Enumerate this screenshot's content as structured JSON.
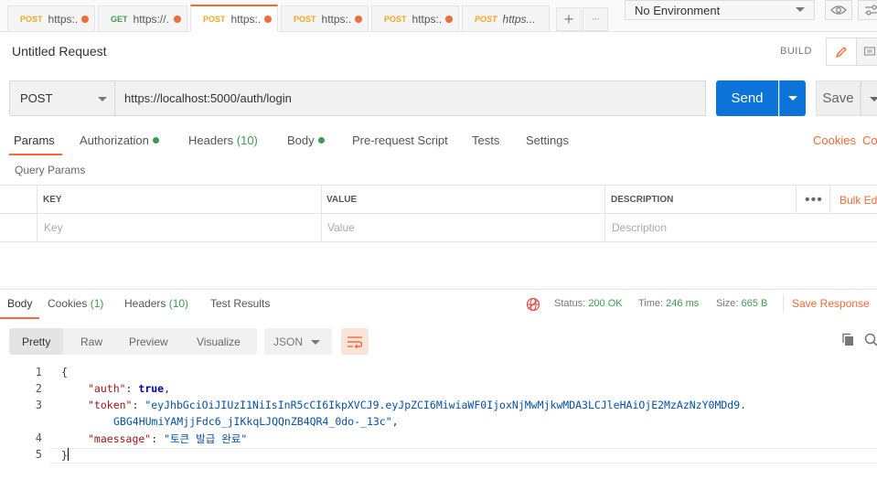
{
  "tabs": [
    {
      "method": "POST",
      "url": "https:...",
      "unsaved": true,
      "active": false
    },
    {
      "method": "GET",
      "url": "https://...",
      "unsaved": true,
      "active": false
    },
    {
      "method": "POST",
      "url": "https:...",
      "unsaved": true,
      "active": true
    },
    {
      "method": "POST",
      "url": "https:...",
      "unsaved": true,
      "active": false
    },
    {
      "method": "POST",
      "url": "https:...",
      "unsaved": true,
      "active": false
    },
    {
      "method": "POST",
      "url": "https...",
      "unsaved": false,
      "active": false
    }
  ],
  "tab_actions": {
    "add": "+",
    "more": "···"
  },
  "environment": {
    "selected": "No Environment"
  },
  "request": {
    "title": "Untitled Request",
    "build_label": "BUILD",
    "method": "POST",
    "url": "https://localhost:5000/auth/login",
    "send_label": "Send",
    "save_label": "Save"
  },
  "request_tabs": {
    "params": "Params",
    "authorization": "Authorization",
    "headers": "Headers",
    "headers_count": "(10)",
    "body": "Body",
    "prerequest": "Pre-request Script",
    "tests": "Tests",
    "settings": "Settings",
    "cookies": "Cookies",
    "code": "Code"
  },
  "query_params": {
    "title": "Query Params",
    "columns": {
      "key": "KEY",
      "value": "VALUE",
      "description": "DESCRIPTION"
    },
    "placeholders": {
      "key": "Key",
      "value": "Value",
      "description": "Description"
    },
    "bulk_edit": "Bulk Edit"
  },
  "response": {
    "tabs": {
      "body": "Body",
      "cookies": "Cookies",
      "cookies_count": "(1)",
      "headers": "Headers",
      "headers_count": "(10)",
      "test_results": "Test Results"
    },
    "status_label": "Status:",
    "status": "200 OK",
    "time_label": "Time:",
    "time": "246 ms",
    "size_label": "Size:",
    "size": "665 B",
    "save_response": "Save Response",
    "views": {
      "pretty": "Pretty",
      "raw": "Raw",
      "preview": "Preview",
      "visualize": "Visualize"
    },
    "format": "JSON",
    "lines": [
      "1",
      "2",
      "3",
      "",
      "4",
      "5"
    ],
    "json": {
      "open": "{",
      "auth_key": "\"auth\"",
      "auth_val": "true",
      "token_key": "\"token\"",
      "token_val_1": "\"eyJhbGciOiJIUzI1NiIsInR5cCI6IkpXVCJ9.eyJpZCI6MiwiaWF0IjoxNjMwMjkwMDA3LCJleHAiOjE2MzAzNzY0MDd9.",
      "token_val_2": "GBG4HUmiYAMjjFdc6_jIKkqLJQQnZB4QR4_0do-_13c\"",
      "maessage_key": "\"maessage\"",
      "maessage_val": "\"토큰 발급 완료\"",
      "close": "}"
    }
  },
  "colors": {
    "accent": "#f26b3a",
    "send": "#0b73d9",
    "success": "#3d9a50"
  }
}
